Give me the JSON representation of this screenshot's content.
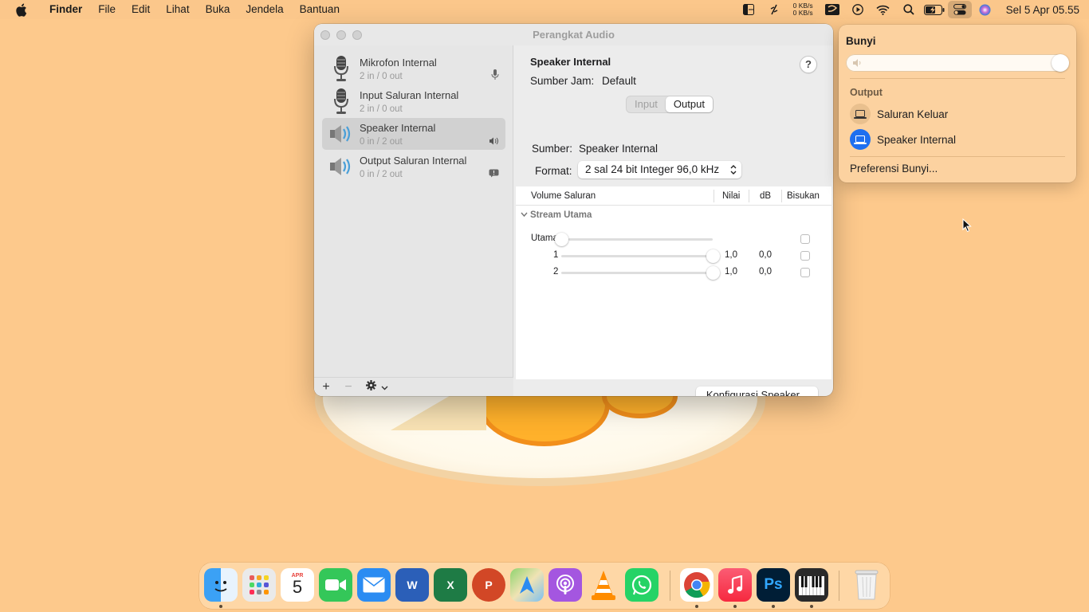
{
  "menubar": {
    "app_name": "Finder",
    "items": [
      "File",
      "Edit",
      "Lihat",
      "Buka",
      "Jendela",
      "Bantuan"
    ],
    "net_up": "0 KB/s",
    "net_down": "0 KB/s",
    "clock": "Sel 5 Apr  05.55"
  },
  "window": {
    "title": "Perangkat Audio",
    "devices": [
      {
        "name": "Mikrofon Internal",
        "io": "2 in / 0 out",
        "icon": "microphone-icon",
        "badge": "mic-badge-icon"
      },
      {
        "name": "Input Saluran Internal",
        "io": "2 in / 0 out",
        "icon": "microphone-icon",
        "badge": ""
      },
      {
        "name": "Speaker Internal",
        "io": "0 in / 2 out",
        "icon": "speaker-icon",
        "badge": "speaker-badge-icon",
        "selected": true
      },
      {
        "name": "Output Saluran Internal",
        "io": "0 in / 2 out",
        "icon": "speaker-icon",
        "badge": "alert-badge-icon"
      }
    ],
    "footer": {
      "add": "+",
      "remove": "−"
    },
    "detail": {
      "device_title": "Speaker Internal",
      "clock_label": "Sumber Jam:",
      "clock_value": "Default",
      "help": "?",
      "tabs": [
        "Input",
        "Output"
      ],
      "active_tab": "Output",
      "source_label": "Sumber:",
      "source_value": "Speaker Internal",
      "format_label": "Format:",
      "format_value": "2 sal 24 bit Integer 96,0 kHz",
      "table_headers": {
        "channel": "Volume Saluran",
        "value": "Nilai",
        "db": "dB",
        "mute": "Bisukan"
      },
      "stream_label": "Stream Utama",
      "channels": [
        {
          "name": "Utama",
          "value": "",
          "db": "",
          "level": 0.0
        },
        {
          "name": "1",
          "value": "1,0",
          "db": "0,0",
          "level": 1.0
        },
        {
          "name": "2",
          "value": "1,0",
          "db": "0,0",
          "level": 1.0
        }
      ],
      "configure_button": "Konfigurasi Speaker..."
    }
  },
  "popover": {
    "title": "Bunyi",
    "volume_level": 1.0,
    "output_label": "Output",
    "outputs": [
      {
        "name": "Saluran Keluar",
        "selected": false
      },
      {
        "name": "Speaker Internal",
        "selected": true
      }
    ],
    "preferences_link": "Preferensi Bunyi..."
  },
  "calendar_badge": {
    "month": "APR",
    "day": "5"
  },
  "dock": {
    "apps": [
      "finder",
      "launchpad",
      "calendar",
      "facetime",
      "mail",
      "word",
      "excel",
      "powerpoint",
      "maps",
      "podcasts",
      "vlc",
      "whatsapp",
      "chrome",
      "music",
      "photoshop",
      "piano",
      "trash"
    ]
  },
  "colors": {
    "desktop": "#fdc98c",
    "accent_blue": "#1e6ff0",
    "popover_bg": "#fcd2a0"
  }
}
